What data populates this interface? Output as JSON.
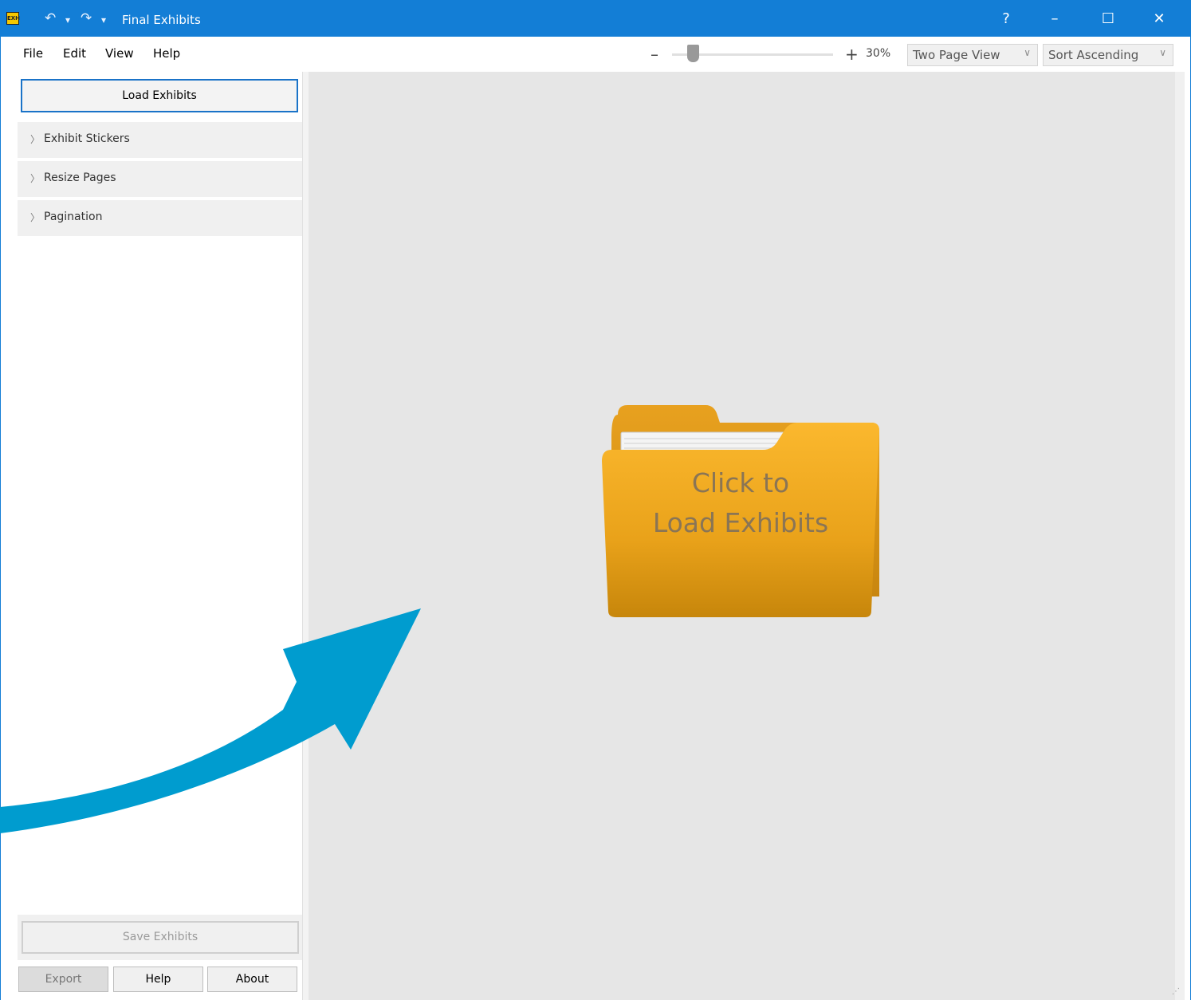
{
  "window": {
    "title": "Final Exhibits",
    "app_icon_text": "EXH",
    "help_glyph": "?",
    "minimize_glyph": "–",
    "maximize_glyph": "☐",
    "close_glyph": "✕",
    "undo_glyph": "↶",
    "redo_glyph": "↷",
    "dropdown_glyph": "▾"
  },
  "menu": {
    "file": "File",
    "edit": "Edit",
    "view": "View",
    "help": "Help"
  },
  "toolbar": {
    "zoom_minus": "–",
    "zoom_plus": "+",
    "zoom_level": "30%",
    "zoom_fraction": 0.13,
    "view_mode": {
      "selected": "Two Page View"
    },
    "sort": {
      "selected": "Sort Ascending"
    },
    "chevron": "∨"
  },
  "sidebar": {
    "load_button": "Load Exhibits",
    "sections": [
      {
        "label": "Exhibit Stickers",
        "chevron": "〉"
      },
      {
        "label": "Resize Pages",
        "chevron": "〉"
      },
      {
        "label": "Pagination",
        "chevron": "〉"
      }
    ],
    "save_button": "Save Exhibits",
    "export_button": "Export",
    "help_button": "Help",
    "about_button": "About"
  },
  "canvas": {
    "prompt_line1": "Click to",
    "prompt_line2": "Load Exhibits"
  },
  "colors": {
    "titlebar": "#137ed6",
    "folder_top": "#f9b42b",
    "folder_bottom": "#c7860b",
    "arrow": "#009ccf",
    "canvas_bg": "#e6e6e6"
  }
}
